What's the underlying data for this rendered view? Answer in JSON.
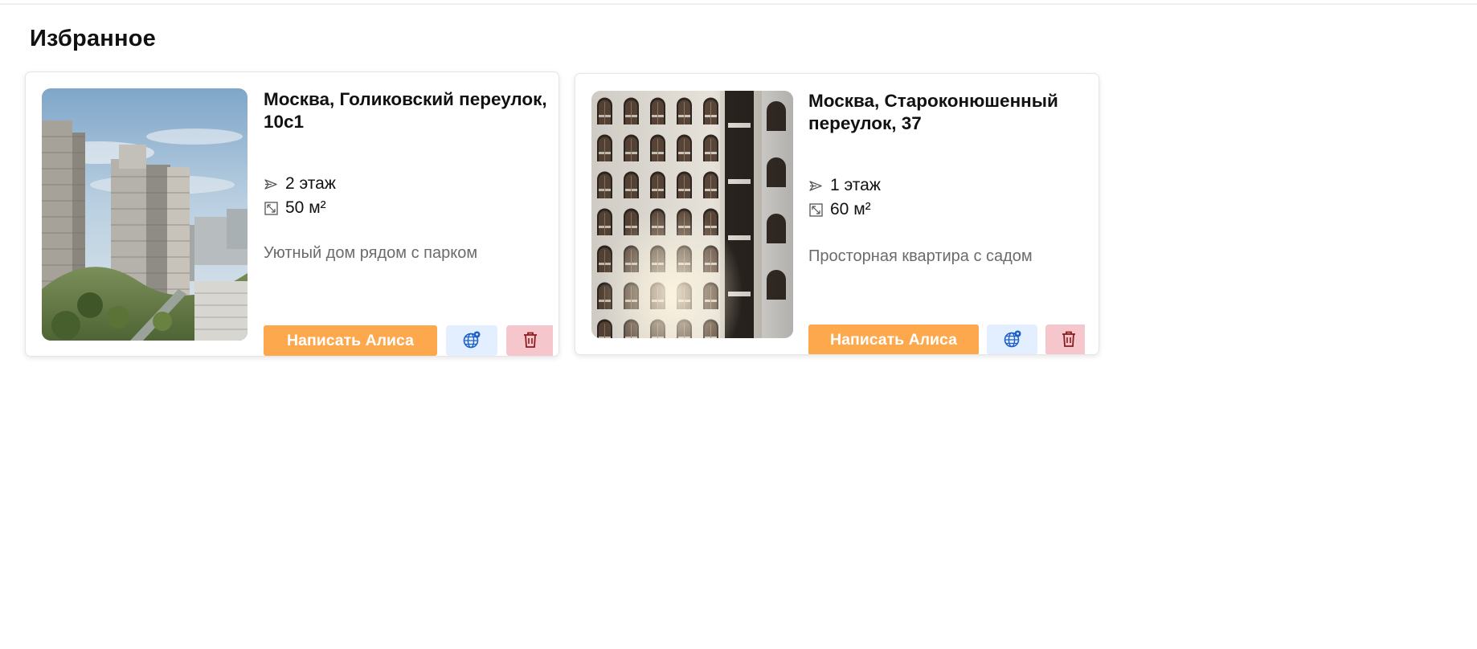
{
  "page": {
    "title": "Избранное"
  },
  "favorites": [
    {
      "title": "Москва, Голиковский переулок, 10с1",
      "floor": "2 этаж",
      "area": "50 м²",
      "description": "Уютный дом рядом с парком",
      "write_label": "Написать Алиса",
      "photo": "residential-towers-photo"
    },
    {
      "title": "Москва, Староконюшенный переулок, 37",
      "floor": "1 этаж",
      "area": "60 м²",
      "description": "Просторная квартира с садом",
      "write_label": "Написать Алиса",
      "photo": "arched-facade-photo"
    }
  ],
  "icons": {
    "floor": "floor-arrow-icon",
    "area": "area-resize-icon",
    "map": "globe-pin-icon",
    "delete": "trash-icon"
  },
  "colors": {
    "write_button": "#fea84e",
    "map_button": "#e3efff",
    "map_icon": "#1c5fc9",
    "delete_button": "#f5c6cb",
    "delete_icon": "#8a1c1c",
    "description_text": "#6b6b6b"
  }
}
